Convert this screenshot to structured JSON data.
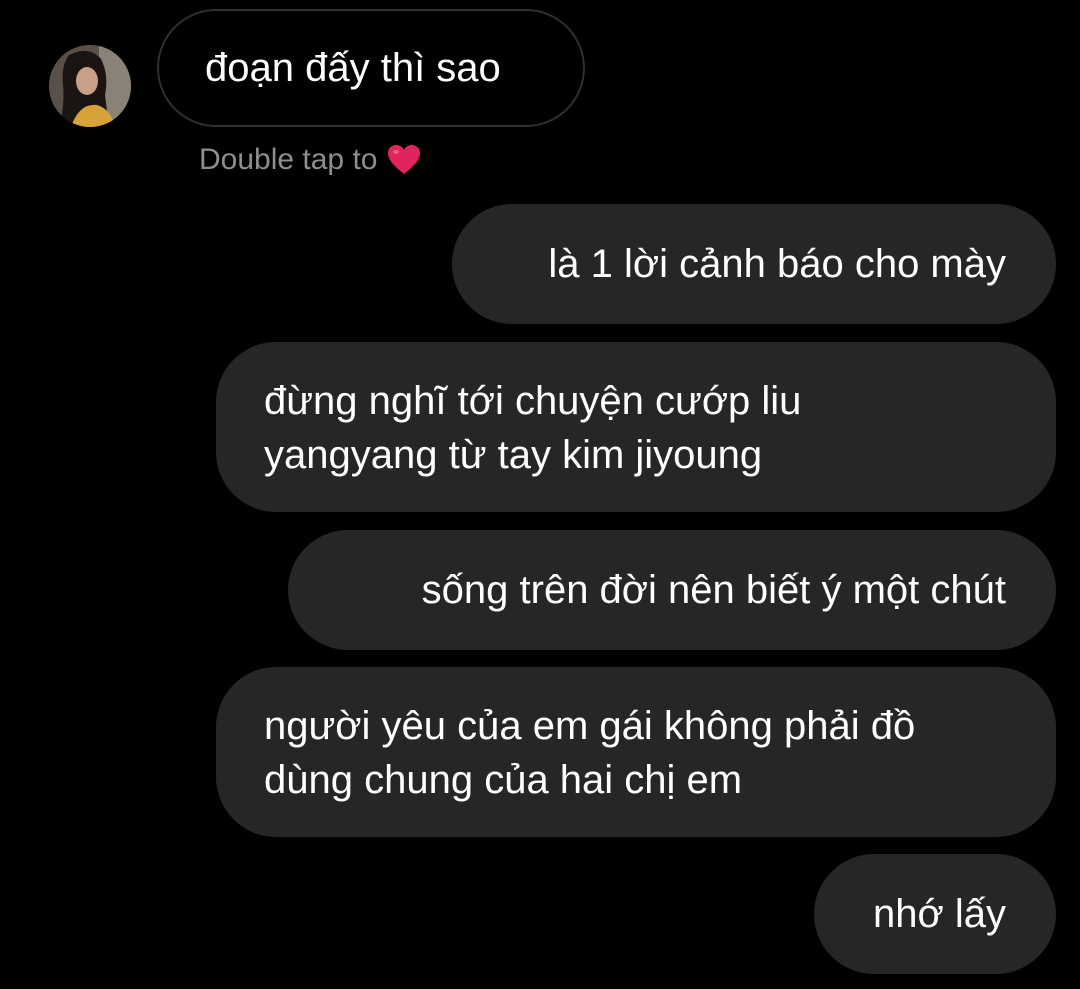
{
  "thread": {
    "incoming": [
      {
        "text": "đoạn đấy thì sao"
      }
    ],
    "reaction_hint": {
      "text": "Double tap to",
      "icon": "red-heart-icon",
      "icon_color": "#e0245e"
    },
    "outgoing": [
      {
        "text": "là 1 lời cảnh báo cho mày"
      },
      {
        "line1": "đừng nghĩ tới chuyện cướp liu",
        "line2": "yangyang từ tay kim jiyoung"
      },
      {
        "text": "sống trên đời nên biết ý một chút"
      },
      {
        "line1": "người yêu của em gái không phải đồ",
        "line2": "dùng chung của hai chị em"
      },
      {
        "text": "nhớ lấy"
      }
    ]
  },
  "colors": {
    "background": "#000000",
    "outgoing_bubble": "#262626",
    "incoming_border": "#2f2f2f",
    "hint_text": "#8e8e8e"
  }
}
